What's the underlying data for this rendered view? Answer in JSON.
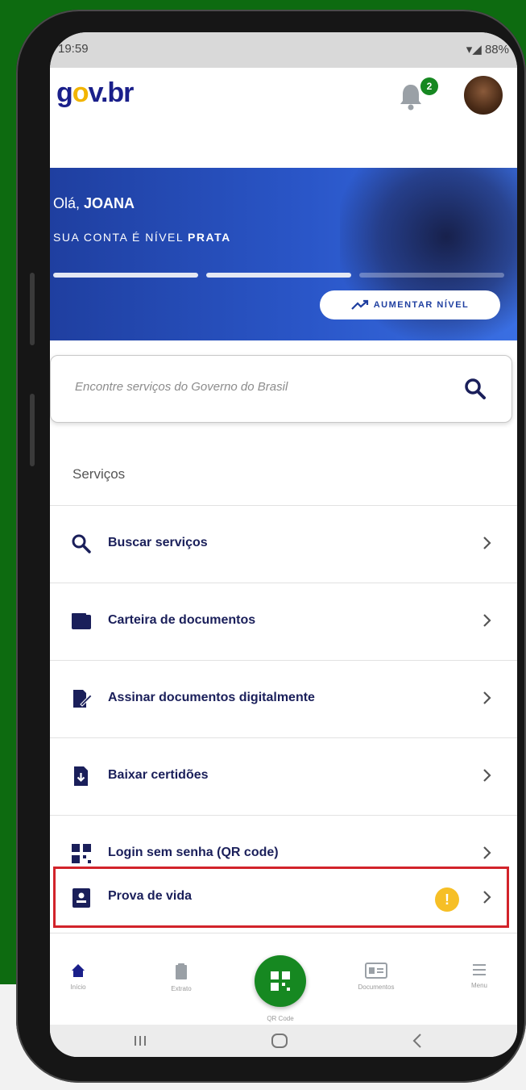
{
  "status_bar": {
    "time": "19:59",
    "indicators": "88%"
  },
  "app": {
    "logo": {
      "prefix": "g",
      "o": "o",
      "suffix": "v.br"
    },
    "notifications_count": "2"
  },
  "hero": {
    "greeting_prefix": "Olá, ",
    "user_name": "JOANA",
    "level_prefix": "SUA CONTA É NÍVEL ",
    "level_name": "PRATA",
    "level_progress": 0.66,
    "upgrade_button": "AUMENTAR NÍVEL"
  },
  "search": {
    "placeholder": "Encontre serviços do Governo do Brasil"
  },
  "services": {
    "title": "Serviços",
    "items": [
      {
        "label": "Buscar serviços",
        "icon": "search-icon"
      },
      {
        "label": "Carteira de documentos",
        "icon": "wallet-icon"
      },
      {
        "label": "Assinar documentos digitalmente",
        "icon": "signature-icon"
      },
      {
        "label": "Baixar certidões",
        "icon": "download-document-icon"
      },
      {
        "label": "Login sem senha (QR code)",
        "icon": "qr-code-icon"
      },
      {
        "label": "Prova de vida",
        "icon": "id-badge-icon",
        "alert": "!"
      }
    ]
  },
  "bottom_nav": {
    "items": [
      {
        "label": "Início",
        "icon": "home-icon"
      },
      {
        "label": "Extrato",
        "icon": "clipboard-icon"
      },
      {
        "label": "QR Code",
        "icon": "qr-code-icon"
      },
      {
        "label": "Documentos",
        "icon": "id-card-icon"
      },
      {
        "label": "Menu",
        "icon": "menu-icon"
      }
    ]
  },
  "colors": {
    "accent": "#1f3fa0",
    "green": "#168821",
    "highlight": "#d2232a",
    "warning": "#f6bf26"
  }
}
